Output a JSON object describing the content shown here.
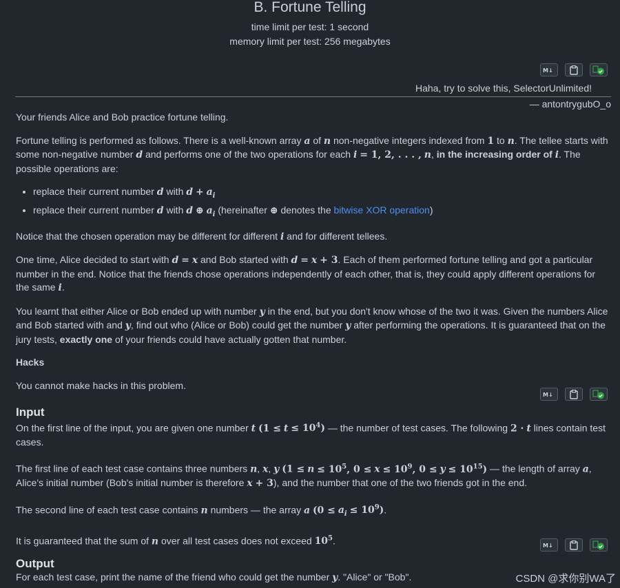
{
  "problem": {
    "title": "B. Fortune Telling",
    "time_limit": "time limit per test: 1 second",
    "memory_limit": "memory limit per test: 256 megabytes"
  },
  "toolbar_icons": [
    "markdown-icon",
    "clipboard-icon",
    "submit-check-icon"
  ],
  "epigraph": {
    "text": "Haha, try to solve this, SelectorUnlimited!",
    "author": "— antontrygubO_o"
  },
  "statement": {
    "p1": "Your friends Alice and Bob practice fortune telling.",
    "p2a": "Fortune telling is performed as follows. There is a well-known array ",
    "p2b": " of ",
    "p2c": " non-negative integers indexed from ",
    "p2d": " to ",
    "p2e": ". The tellee starts with some non-negative number ",
    "p2f": " and performs one of the two operations for each ",
    "p2g": ", ",
    "p2h": "in the increasing order of ",
    "p2i": ". The possible operations are:",
    "li1": "replace their current number ",
    "li1b": " with ",
    "li2": "replace their current number ",
    "li2b": " with ",
    "li2c": " (hereinafter ",
    "li2d": " denotes the ",
    "li2link": "bitwise XOR operation",
    "li2e": ")",
    "p3a": "Notice that the chosen operation may be different for different ",
    "p3b": " and for different tellees.",
    "p4a": "One time, Alice decided to start with ",
    "p4b": " and Bob started with ",
    "p4c": ". Each of them performed fortune telling and got a particular number in the end. Notice that the friends chose operations independently of each other, that is, they could apply different operations for the same ",
    "p4d": ".",
    "p5a": "You learnt that either Alice or Bob ended up with number ",
    "p5b": " in the end, but you don't know whose of the two it was. Given the numbers Alice and Bob started with and ",
    "p5c": ", find out who (Alice or Bob) could get the number ",
    "p5d": " after performing the operations. It is guaranteed that on the jury tests, ",
    "p5bold": "exactly one",
    "p5e": " of your friends could have actually gotten that number.",
    "hacks_title": "Hacks",
    "hacks_text": "You cannot make hacks in this problem."
  },
  "input_section": {
    "title": "Input",
    "p1a": "On the first line of the input, you are given one number ",
    "p1b": " — the number of test cases. The following ",
    "p1c": " lines contain test cases.",
    "p2a": "The first line of each test case contains three numbers ",
    "p2b": " — the length of array ",
    "p2c": ", Alice's initial number (Bob's initial number is therefore ",
    "p2d": "), and the number that one of the two friends got in the end.",
    "p3a": "The second line of each test case contains ",
    "p3b": " numbers — the array ",
    "p3c": ".",
    "p4a": "It is guaranteed that the sum of ",
    "p4b": " over all test cases does not exceed ",
    "p4c": "."
  },
  "output_section": {
    "title": "Output",
    "p1a": "For each test case, print the name of the friend who could get the number ",
    "p1b": ". \"Alice\" or \"Bob\"."
  },
  "watermark": "CSDN @求你别WA了",
  "colors": {
    "background": "#22272e",
    "text": "#c9d1d9",
    "link": "#4f8ff0",
    "check_green": "#2ea043"
  }
}
